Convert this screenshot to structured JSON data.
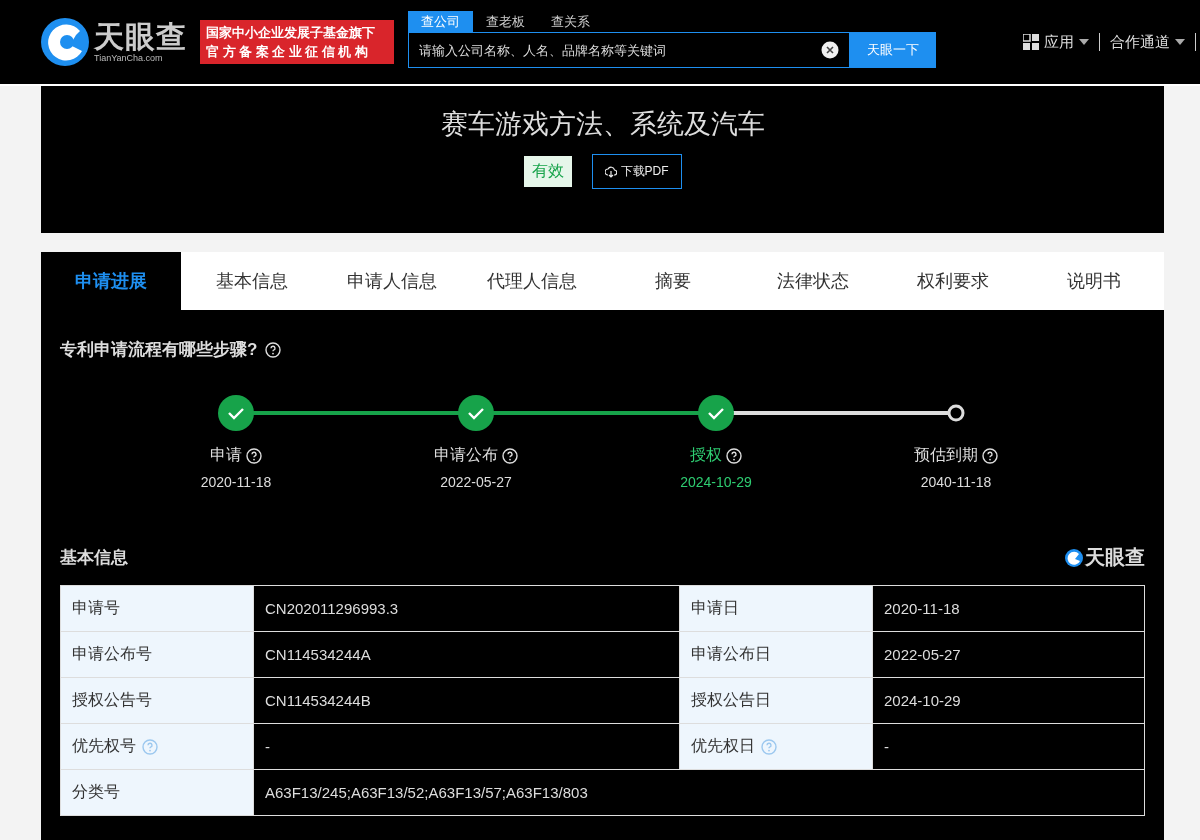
{
  "header": {
    "logo": {
      "name": "天眼查",
      "domain": "TianYanCha.com"
    },
    "badge_lines": [
      "国家中小企业发展子基金旗下",
      "官方备案企业征信机构"
    ],
    "search": {
      "tabs": [
        {
          "label": "查公司",
          "selected": true
        },
        {
          "label": "查老板",
          "selected": false
        },
        {
          "label": "查关系",
          "selected": false
        }
      ],
      "placeholder": "请输入公司名称、人名、品牌名称等关键词",
      "button": "天眼一下"
    },
    "nav": [
      {
        "label": "应用",
        "kind": "apps"
      },
      {
        "label": "合作通道",
        "kind": "menu"
      }
    ]
  },
  "patent": {
    "title": "赛车游戏方法、系统及汽车",
    "status": "有效",
    "download": "下载PDF"
  },
  "tabs": [
    {
      "label": "申请进展",
      "selected": true
    },
    {
      "label": "基本信息",
      "selected": false
    },
    {
      "label": "申请人信息",
      "selected": false
    },
    {
      "label": "代理人信息",
      "selected": false
    },
    {
      "label": "摘要",
      "selected": false
    },
    {
      "label": "法律状态",
      "selected": false
    },
    {
      "label": "权利要求",
      "selected": false
    },
    {
      "label": "说明书",
      "selected": false
    }
  ],
  "progress": {
    "heading": "专利申请流程有哪些步骤?",
    "steps": [
      {
        "label": "申请",
        "date": "2020-11-18",
        "done": true,
        "current": false
      },
      {
        "label": "申请公布",
        "date": "2022-05-27",
        "done": true,
        "current": false
      },
      {
        "label": "授权",
        "date": "2024-10-29",
        "done": true,
        "current": true
      },
      {
        "label": "预估到期",
        "date": "2040-11-18",
        "done": false,
        "current": false
      }
    ]
  },
  "basic_info": {
    "heading": "基本信息",
    "brand": "天眼查",
    "rows": [
      [
        {
          "key": "申请号",
          "value": "CN202011296993.3"
        },
        {
          "key": "申请日",
          "value": "2020-11-18"
        }
      ],
      [
        {
          "key": "申请公布号",
          "value": "CN114534244A"
        },
        {
          "key": "申请公布日",
          "value": "2022-05-27"
        }
      ],
      [
        {
          "key": "授权公告号",
          "value": "CN114534244B"
        },
        {
          "key": "授权公告日",
          "value": "2024-10-29"
        }
      ],
      [
        {
          "key": "优先权号",
          "value": "-",
          "help": true
        },
        {
          "key": "优先权日",
          "value": "-",
          "help": true
        }
      ],
      [
        {
          "key": "分类号",
          "value": "A63F13/245;A63F13/52;A63F13/57;A63F13/803"
        }
      ]
    ]
  }
}
